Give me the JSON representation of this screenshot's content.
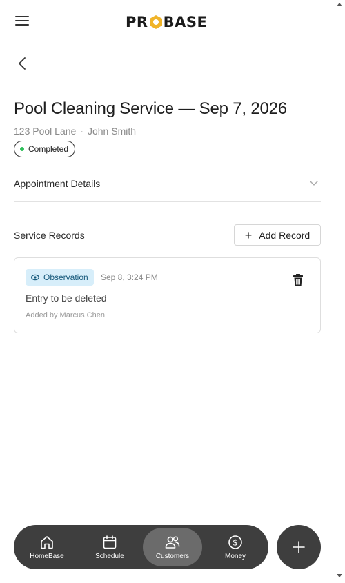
{
  "app": {
    "logo_text_left": "PR",
    "logo_text_right": "BASE",
    "brand_color": "#f0b429"
  },
  "page": {
    "title": "Pool Cleaning Service — Sep 7, 2026",
    "address": "123 Pool Lane",
    "separator": "·",
    "customer": "John Smith",
    "status": "Completed",
    "status_color": "#2fbf5a"
  },
  "appointment": {
    "label": "Appointment Details"
  },
  "service_records": {
    "label": "Service Records",
    "add_label": "Add Record",
    "records": [
      {
        "type": "Observation",
        "time": "Sep 8, 3:24 PM",
        "text": "Entry to be deleted",
        "author": "Added by Marcus Chen"
      }
    ]
  },
  "nav": {
    "items": [
      {
        "label": "HomeBase",
        "icon": "home-icon"
      },
      {
        "label": "Schedule",
        "icon": "calendar-icon"
      },
      {
        "label": "Customers",
        "icon": "users-icon",
        "active": true
      },
      {
        "label": "Money",
        "icon": "dollar-icon"
      }
    ],
    "fab_icon": "plus-icon"
  }
}
